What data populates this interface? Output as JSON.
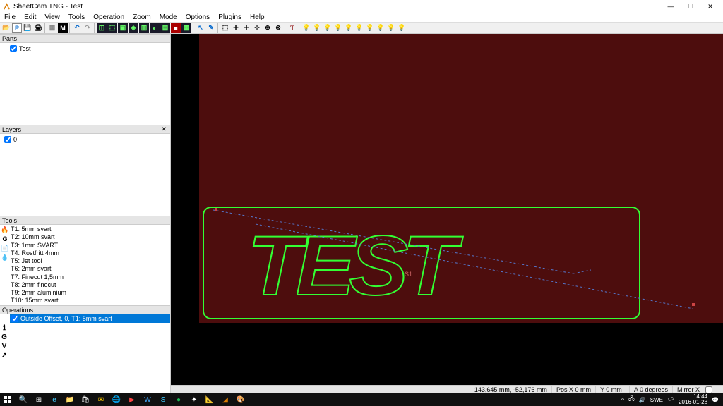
{
  "window": {
    "title": "SheetCam TNG - Test",
    "min": "—",
    "max": "☐",
    "close": "✕"
  },
  "menu": [
    "File",
    "Edit",
    "View",
    "Tools",
    "Operation",
    "Zoom",
    "Mode",
    "Options",
    "Plugins",
    "Help"
  ],
  "panels": {
    "parts": {
      "title": "Parts",
      "item": "Test"
    },
    "layers": {
      "title": "Layers",
      "item": "0"
    },
    "tools": {
      "title": "Tools",
      "items": [
        "T1: 5mm svart",
        "T2: 10mm svart",
        "T3: 1mm SVART",
        "T4: Rostfritt 4mm",
        "T5: Jet tool",
        "T6: 2mm svart",
        "T7: Finecut 1,5mm",
        "T8: 2mm finecut",
        "T9: 2mm aluminium",
        "T10: 15mm svart"
      ]
    },
    "operations": {
      "title": "Operations",
      "item": "Outside Offset, 0, T1: 5mm svart"
    }
  },
  "canvas": {
    "text": "TEST",
    "label": "S1"
  },
  "status": {
    "coords": "143,645 mm, -52,176 mm",
    "posx": "Pos X 0 mm",
    "posy": "Y 0 mm",
    "angle": "A 0 degrees",
    "mirror": "Mirror X"
  },
  "tray": {
    "lang": "SWE",
    "time": "14:44",
    "date": "2016-01-28"
  }
}
